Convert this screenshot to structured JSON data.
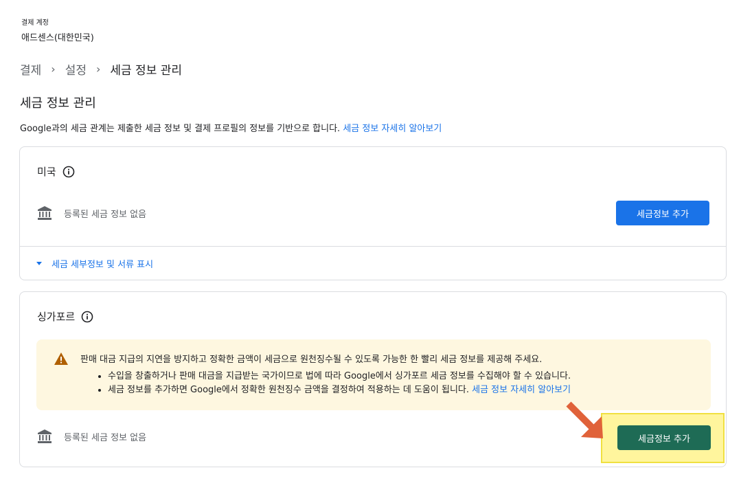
{
  "account": {
    "label": "결제 계정",
    "name": "애드센스(대한민국)"
  },
  "breadcrumb": {
    "items": [
      "결제",
      "설정",
      "세금 정보 관리"
    ],
    "separator": "›"
  },
  "page": {
    "title": "세금 정보 관리",
    "description": "Google과의 세금 관계는 제출한 세금 정보 및 결제 프로필의 정보를 기반으로 합니다. ",
    "learn_more": "세금 정보 자세히 알아보기"
  },
  "us_card": {
    "country": "미국",
    "no_info": "등록된 세금 정보 없음",
    "add_button": "세금정보 추가",
    "expand_link": "세금 세부정보 및 서류 표시"
  },
  "sg_card": {
    "country": "싱가포르",
    "warning": {
      "main": "판매 대금 지급의 지연을 방지하고 정확한 금액이 세금으로 원천징수될 수 있도록 가능한 한 빨리 세금 정보를 제공해 주세요.",
      "bullets": [
        "수입을 창출하거나 판매 대금을 지급받는 국가이므로 법에 따라 Google에서 싱가포르 세금 정보를 수집해야 할 수 있습니다.",
        "세금 정보를 추가하면 Google에서 정확한 원천징수 금액을 결정하여 적용하는 데 도움이 됩니다. "
      ],
      "learn_more": "세금 정보 자세히 알아보기"
    },
    "no_info": "등록된 세금 정보 없음",
    "add_button": "세금정보 추가"
  },
  "colors": {
    "primary_blue": "#1a73e8",
    "highlight_yellow": "#fff59d",
    "button_green": "#1e6b55",
    "arrow_orange": "#e0623a",
    "warning_bg": "#fef7e0"
  }
}
